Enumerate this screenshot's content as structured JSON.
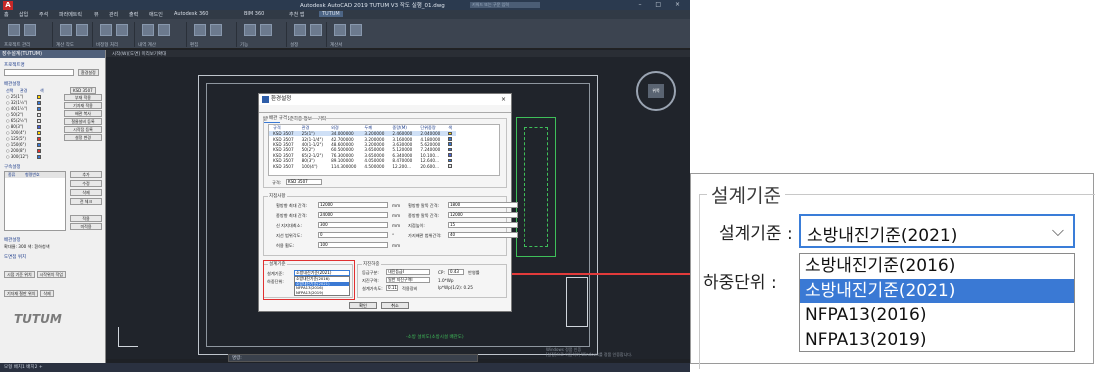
{
  "app": {
    "logo": "A",
    "title": "Autodesk AutoCAD 2019   TUTUM V3 작도 실행_01.dwg",
    "search_placeholder": "키워드 또는 구문 입력",
    "window_controls": "– □ ×"
  },
  "ribbon": {
    "tabs": [
      "홈",
      "삽입",
      "주석",
      "파라메트릭",
      "뷰",
      "관리",
      "출력",
      "애드인",
      "Autodesk 360",
      "BIM 360",
      "추천 앱",
      "TUTUM"
    ],
    "active_tab": "TUTUM",
    "groups": [
      "프로젝트 관리",
      "계산 작도",
      "비정형 처리",
      "내역 계산",
      "편집",
      "기능",
      "설정",
      "계산서"
    ]
  },
  "left_panel": {
    "title": "장수설계(TUTUM)",
    "project_section": "프로젝트명",
    "project_button": "환경설정",
    "steel_section": "배관설정",
    "steel_headers": [
      "선택",
      "관경",
      "색"
    ],
    "steel_dropdown": "KSD 3507",
    "steel_rows": [
      {
        "label": "25(1\")",
        "color": "#ffd400"
      },
      {
        "label": "32(1¼\")",
        "color": "#3a79d4"
      },
      {
        "label": "40(1½\")",
        "color": "#3a79d4"
      },
      {
        "label": "50(2\")",
        "color": "#e6e6e6"
      },
      {
        "label": "65(2½\")",
        "color": "#e6e6e6"
      },
      {
        "label": "80(3\")",
        "color": "#4a63d8"
      },
      {
        "label": "100(4\")",
        "color": "#ffd400"
      },
      {
        "label": "125(5\")",
        "color": "#e03030"
      },
      {
        "label": "150(6\")",
        "color": "#3a79d4"
      },
      {
        "label": "200(8\")",
        "color": "#e03030"
      },
      {
        "label": "300(12\")",
        "color": "#3a79d4"
      }
    ],
    "side_buttons": [
      "부재 적용",
      "기자재 적용",
      "배관 복사",
      "철물설비 등록",
      "시작점 등록",
      "설정 변경"
    ],
    "support_section": "구속설정",
    "support_headers": [
      "종류",
      "형명번호"
    ],
    "support_buttons": [
      "추가",
      "수정",
      "삭제",
      "전 체크"
    ],
    "support_bottom": [
      "적용",
      "미적용"
    ],
    "option_section": "배관설정",
    "option_row": "확대율: 300   색: 흰하청색",
    "anchor_section": "도면점 위치",
    "anchor_buttons": [
      "시점 기준 위치",
      "시작위치 작업",
      "기자재 철판 위치",
      "삭제"
    ],
    "brand": "TUTUM"
  },
  "drawing": {
    "tab_label": "시작(W)[도면] 미리보기확대",
    "compass_center": "위쪽",
    "command_prompt": "명령:",
    "status_text": "모형   배치1   배치2   +",
    "windows_activation": [
      "Windows 정품 인증",
      "[설정]으로 이동하여 Windows를 정품 인증합니다."
    ],
    "side_note": "-소방 설비도(소방시설 배관도)"
  },
  "dialog": {
    "title": "환경설정",
    "tabs": [
      "일반사항",
      "표준하중 정보",
      "기타"
    ],
    "material_section": "배관 규격",
    "table_headers": [
      "규격",
      "관경",
      "외경",
      "두께",
      "중량(M)",
      "단위중량",
      "색"
    ],
    "table_rows": [
      [
        "KSD 3507",
        "25(1\")",
        "34.000000",
        "3.200000",
        "2.460000",
        "2.040000",
        "#ffd400"
      ],
      [
        "KSD 3507",
        "32(1-1/4\")",
        "42.700000",
        "3.200000",
        "3.160000",
        "4.180000",
        "#3a79d4"
      ],
      [
        "KSD 3507",
        "40(1-1/2\")",
        "48.600000",
        "3.200000",
        "3.630000",
        "5.620000",
        "#3a79d4"
      ],
      [
        "KSD 3507",
        "50(2\")",
        "60.500000",
        "3.650000",
        "5.120000",
        "7.240000",
        "#3a79d4"
      ],
      [
        "KSD 3507",
        "65(2-1/2\")",
        "76.300000",
        "3.650000",
        "6.340000",
        "10.100...",
        "#4a63d8"
      ],
      [
        "KSD 3507",
        "80(3\")",
        "89.100000",
        "4.050000",
        "8.470000",
        "12.640...",
        "#3a79d4"
      ],
      [
        "KSD 3507",
        "100(4\")",
        "114.300000",
        "4.500000",
        "12.200...",
        "20.600...",
        "#e6e6e6"
      ]
    ],
    "standard_label": "규격:",
    "standard_value": "KSD 3507",
    "spacing_section": "지점사항",
    "spacing_left": [
      {
        "label": "횡방향 최대 간격:",
        "value": "12000",
        "unit": "mm"
      },
      {
        "label": "종방향 최대 간격:",
        "value": "24000",
        "unit": "mm"
      },
      {
        "label": "신 지지대최소:",
        "value": "300",
        "unit": "mm"
      },
      {
        "label": "지선 범위각도:",
        "value": "0",
        "unit": "°"
      },
      {
        "label": "허용 휨도:",
        "value": "100",
        "unit": "mm"
      }
    ],
    "spacing_right": [
      {
        "label": "횡방향 말뚝 간격:",
        "value": "1800",
        "unit": "mm"
      },
      {
        "label": "종방향 말뚝 간격:",
        "value": "12000",
        "unit": "mm"
      },
      {
        "label": "지점높이:",
        "value": "15",
        "unit": "mm"
      },
      {
        "label": "가지배관 범위간격:",
        "value": "40",
        "unit": "mm"
      }
    ],
    "design_section": "설계기준",
    "design_label": "설계기준:",
    "design_value": "소방내진기준(2021)",
    "design_options": [
      "소방내진기준(2016)",
      "소방내진기준(2021)",
      "NFPA13(2016)",
      "NFPA13(2019)"
    ],
    "load_label": "하중단위:",
    "other_section": "지진하중",
    "seismic_label": "등급구분:",
    "seismic_value": "내진등급Ⅰ",
    "zone_label": "지진구역:",
    "zone_value": "일반 지진구역Ⅰ",
    "factor_label": "설계가속도:",
    "factor_value": "0.11",
    "apply_check": "적용장비",
    "cp_label": "CP:",
    "cp_value": "0.43",
    "ip_check": "반영률",
    "fp_lines": [
      "1.0*Wp",
      "Ip*Wp(1/2): 0.25"
    ],
    "ok": "확인",
    "cancel": "취소"
  },
  "callout": {
    "group_title": "설계기준",
    "design_label": "설계기준 :",
    "load_label": "하중단위 :",
    "selected_value": "소방내진기준(2021)",
    "chevron": "⌵",
    "options": [
      "소방내진기준(2016)",
      "소방내진기준(2021)",
      "NFPA13(2016)",
      "NFPA13(2019)"
    ],
    "highlighted_index": 1,
    "highlight_color": "#3a79d4",
    "callout_line_color": "#e23b3b"
  }
}
